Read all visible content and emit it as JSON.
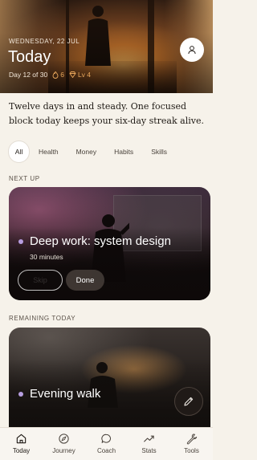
{
  "header": {
    "date_label": "WEDNESDAY, 22 JUL",
    "title": "Today",
    "day_progress": "Day 12 of 30",
    "streak": "6",
    "level": "Lv 4"
  },
  "message": "Twelve days in and steady. One focused block today keeps your six-day streak alive.",
  "filters": [
    "All",
    "Health",
    "Money",
    "Habits",
    "Skills"
  ],
  "sections": {
    "next_up": "NEXT UP",
    "remaining": "REMAINING TODAY"
  },
  "next_task": {
    "title": "Deep work: system design",
    "duration": "30 minutes",
    "skip_label": "Skip",
    "done_label": "Done",
    "dot_color": "#b79ee0"
  },
  "remaining_task": {
    "title": "Evening walk",
    "dot_color": "#b79ee0"
  },
  "nav": [
    {
      "label": "Today",
      "icon": "home-icon"
    },
    {
      "label": "Journey",
      "icon": "compass-icon"
    },
    {
      "label": "Coach",
      "icon": "chat-bubble-icon"
    },
    {
      "label": "Stats",
      "icon": "trend-up-icon"
    },
    {
      "label": "Tools",
      "icon": "wrench-icon"
    }
  ],
  "colors": {
    "accent": "#e9a75c",
    "background": "#f6f2ea",
    "dark": "#201a17"
  }
}
